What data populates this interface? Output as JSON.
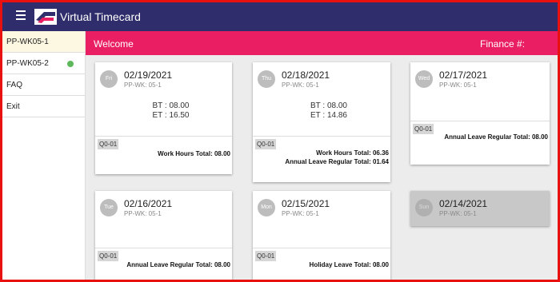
{
  "app": {
    "title": "Virtual Timecard",
    "menu_icon": "hamburger-menu-icon",
    "logo": "usps-eagle-logo"
  },
  "sidebar": {
    "items": [
      {
        "label": "PP-WK05-1",
        "active": true
      },
      {
        "label": "PP-WK05-2",
        "status": "green-dot"
      },
      {
        "label": "FAQ"
      },
      {
        "label": "Exit"
      }
    ]
  },
  "welcome_bar": {
    "welcome": "Welcome",
    "finance": "Finance #:"
  },
  "cards": [
    {
      "day": "Fri",
      "date": "02/19/2021",
      "ppwk": "PP-WK: 05-1",
      "bt": "BT : 08.00",
      "et": "ET : 16.50",
      "code": "Q0-01",
      "totals": [
        "Work Hours Total: 08.00"
      ]
    },
    {
      "day": "Thu",
      "date": "02/18/2021",
      "ppwk": "PP-WK: 05-1",
      "bt": "BT : 08.00",
      "et": "ET : 14.86",
      "code": "Q0-01",
      "totals": [
        "Work Hours Total: 06.36",
        "Annual Leave Regular Total: 01.64"
      ]
    },
    {
      "day": "Wed",
      "date": "02/17/2021",
      "ppwk": "PP-WK: 05-1",
      "code": "Q0-01",
      "totals": [
        "Annual Leave Regular Total: 08.00"
      ]
    },
    {
      "day": "Tue",
      "date": "02/16/2021",
      "ppwk": "PP-WK: 05-1",
      "code": "Q0-01",
      "totals": [
        "Annual Leave Regular Total: 08.00"
      ]
    },
    {
      "day": "Mon",
      "date": "02/15/2021",
      "ppwk": "PP-WK: 05-1",
      "code": "Q0-01",
      "totals": [
        "Holiday Leave Total: 08.00"
      ]
    },
    {
      "day": "Sun",
      "date": "02/14/2021",
      "ppwk": "PP-WK: 05-1"
    }
  ],
  "colors": {
    "header": "#2f2d6b",
    "accent": "#e91e63",
    "border": "#e8110f",
    "status_dot": "#5cb85c"
  }
}
